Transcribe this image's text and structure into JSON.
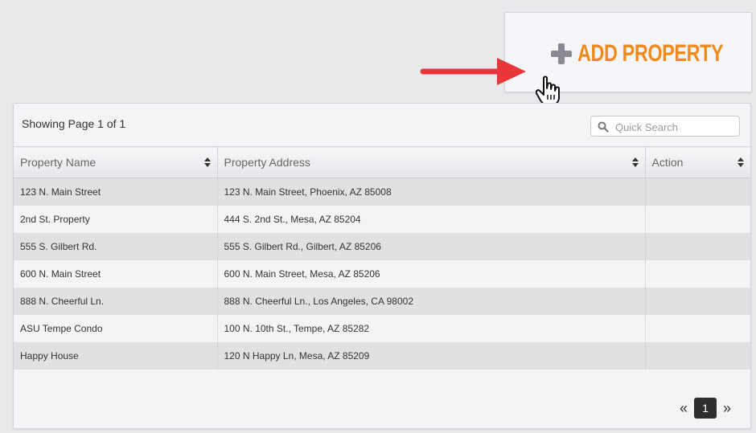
{
  "add_property": {
    "label": "ADD PROPERTY"
  },
  "list": {
    "showing_text": "Showing Page 1 of 1",
    "search_placeholder": "Quick Search",
    "columns": [
      "Property Name",
      "Property Address",
      "Action"
    ],
    "rows": [
      {
        "name": "123 N. Main Street",
        "address": "123 N. Main Street, Phoenix, AZ 85008"
      },
      {
        "name": "2nd St. Property",
        "address": "444 S. 2nd St., Mesa, AZ 85204"
      },
      {
        "name": "555 S. Gilbert Rd.",
        "address": "555 S. Gilbert Rd., Gilbert, AZ 85206"
      },
      {
        "name": "600 N. Main Street",
        "address": "600 N. Main Street, Mesa, AZ 85206"
      },
      {
        "name": "888 N. Cheerful Ln.",
        "address": "888 N. Cheerful Ln., Los Angeles, CA 98002"
      },
      {
        "name": "ASU Tempe Condo",
        "address": "100 N. 10th St., Tempe, AZ 85282"
      },
      {
        "name": "Happy House",
        "address": "120 N Happy Ln, Mesa, AZ 85209"
      }
    ]
  },
  "pagination": {
    "prev": "«",
    "current": "1",
    "next": "»"
  },
  "colors": {
    "accent": "#f08a1c",
    "arrow": "#e8363b",
    "active_page": "#2e2e2e"
  },
  "icons": [
    "plus-icon",
    "pointer-arrow-icon",
    "hand-cursor-icon",
    "search-icon",
    "sort-icon"
  ]
}
